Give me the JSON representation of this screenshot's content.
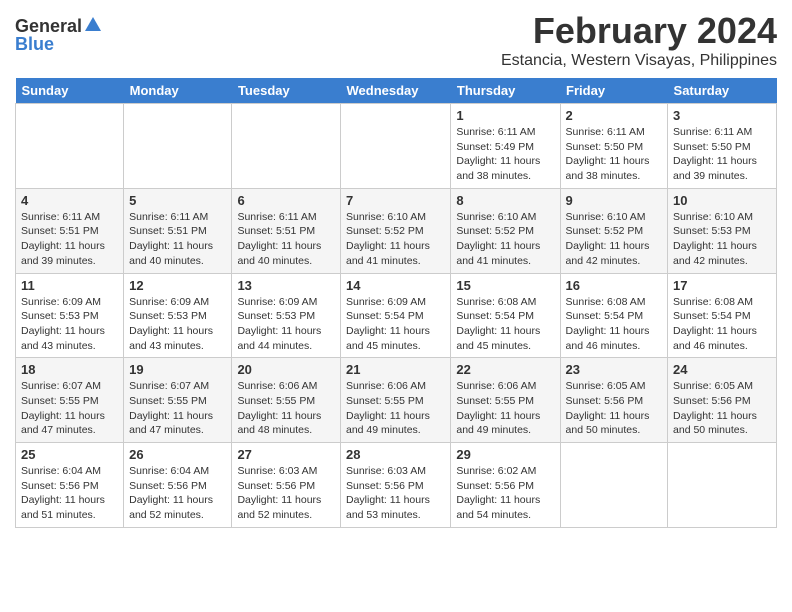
{
  "header": {
    "logo_general": "General",
    "logo_blue": "Blue",
    "month_year": "February 2024",
    "location": "Estancia, Western Visayas, Philippines"
  },
  "weekdays": [
    "Sunday",
    "Monday",
    "Tuesday",
    "Wednesday",
    "Thursday",
    "Friday",
    "Saturday"
  ],
  "weeks": [
    [
      {
        "day": "",
        "info": ""
      },
      {
        "day": "",
        "info": ""
      },
      {
        "day": "",
        "info": ""
      },
      {
        "day": "",
        "info": ""
      },
      {
        "day": "1",
        "info": "Sunrise: 6:11 AM\nSunset: 5:49 PM\nDaylight: 11 hours\nand 38 minutes."
      },
      {
        "day": "2",
        "info": "Sunrise: 6:11 AM\nSunset: 5:50 PM\nDaylight: 11 hours\nand 38 minutes."
      },
      {
        "day": "3",
        "info": "Sunrise: 6:11 AM\nSunset: 5:50 PM\nDaylight: 11 hours\nand 39 minutes."
      }
    ],
    [
      {
        "day": "4",
        "info": "Sunrise: 6:11 AM\nSunset: 5:51 PM\nDaylight: 11 hours\nand 39 minutes."
      },
      {
        "day": "5",
        "info": "Sunrise: 6:11 AM\nSunset: 5:51 PM\nDaylight: 11 hours\nand 40 minutes."
      },
      {
        "day": "6",
        "info": "Sunrise: 6:11 AM\nSunset: 5:51 PM\nDaylight: 11 hours\nand 40 minutes."
      },
      {
        "day": "7",
        "info": "Sunrise: 6:10 AM\nSunset: 5:52 PM\nDaylight: 11 hours\nand 41 minutes."
      },
      {
        "day": "8",
        "info": "Sunrise: 6:10 AM\nSunset: 5:52 PM\nDaylight: 11 hours\nand 41 minutes."
      },
      {
        "day": "9",
        "info": "Sunrise: 6:10 AM\nSunset: 5:52 PM\nDaylight: 11 hours\nand 42 minutes."
      },
      {
        "day": "10",
        "info": "Sunrise: 6:10 AM\nSunset: 5:53 PM\nDaylight: 11 hours\nand 42 minutes."
      }
    ],
    [
      {
        "day": "11",
        "info": "Sunrise: 6:09 AM\nSunset: 5:53 PM\nDaylight: 11 hours\nand 43 minutes."
      },
      {
        "day": "12",
        "info": "Sunrise: 6:09 AM\nSunset: 5:53 PM\nDaylight: 11 hours\nand 43 minutes."
      },
      {
        "day": "13",
        "info": "Sunrise: 6:09 AM\nSunset: 5:53 PM\nDaylight: 11 hours\nand 44 minutes."
      },
      {
        "day": "14",
        "info": "Sunrise: 6:09 AM\nSunset: 5:54 PM\nDaylight: 11 hours\nand 45 minutes."
      },
      {
        "day": "15",
        "info": "Sunrise: 6:08 AM\nSunset: 5:54 PM\nDaylight: 11 hours\nand 45 minutes."
      },
      {
        "day": "16",
        "info": "Sunrise: 6:08 AM\nSunset: 5:54 PM\nDaylight: 11 hours\nand 46 minutes."
      },
      {
        "day": "17",
        "info": "Sunrise: 6:08 AM\nSunset: 5:54 PM\nDaylight: 11 hours\nand 46 minutes."
      }
    ],
    [
      {
        "day": "18",
        "info": "Sunrise: 6:07 AM\nSunset: 5:55 PM\nDaylight: 11 hours\nand 47 minutes."
      },
      {
        "day": "19",
        "info": "Sunrise: 6:07 AM\nSunset: 5:55 PM\nDaylight: 11 hours\nand 47 minutes."
      },
      {
        "day": "20",
        "info": "Sunrise: 6:06 AM\nSunset: 5:55 PM\nDaylight: 11 hours\nand 48 minutes."
      },
      {
        "day": "21",
        "info": "Sunrise: 6:06 AM\nSunset: 5:55 PM\nDaylight: 11 hours\nand 49 minutes."
      },
      {
        "day": "22",
        "info": "Sunrise: 6:06 AM\nSunset: 5:55 PM\nDaylight: 11 hours\nand 49 minutes."
      },
      {
        "day": "23",
        "info": "Sunrise: 6:05 AM\nSunset: 5:56 PM\nDaylight: 11 hours\nand 50 minutes."
      },
      {
        "day": "24",
        "info": "Sunrise: 6:05 AM\nSunset: 5:56 PM\nDaylight: 11 hours\nand 50 minutes."
      }
    ],
    [
      {
        "day": "25",
        "info": "Sunrise: 6:04 AM\nSunset: 5:56 PM\nDaylight: 11 hours\nand 51 minutes."
      },
      {
        "day": "26",
        "info": "Sunrise: 6:04 AM\nSunset: 5:56 PM\nDaylight: 11 hours\nand 52 minutes."
      },
      {
        "day": "27",
        "info": "Sunrise: 6:03 AM\nSunset: 5:56 PM\nDaylight: 11 hours\nand 52 minutes."
      },
      {
        "day": "28",
        "info": "Sunrise: 6:03 AM\nSunset: 5:56 PM\nDaylight: 11 hours\nand 53 minutes."
      },
      {
        "day": "29",
        "info": "Sunrise: 6:02 AM\nSunset: 5:56 PM\nDaylight: 11 hours\nand 54 minutes."
      },
      {
        "day": "",
        "info": ""
      },
      {
        "day": "",
        "info": ""
      }
    ]
  ]
}
